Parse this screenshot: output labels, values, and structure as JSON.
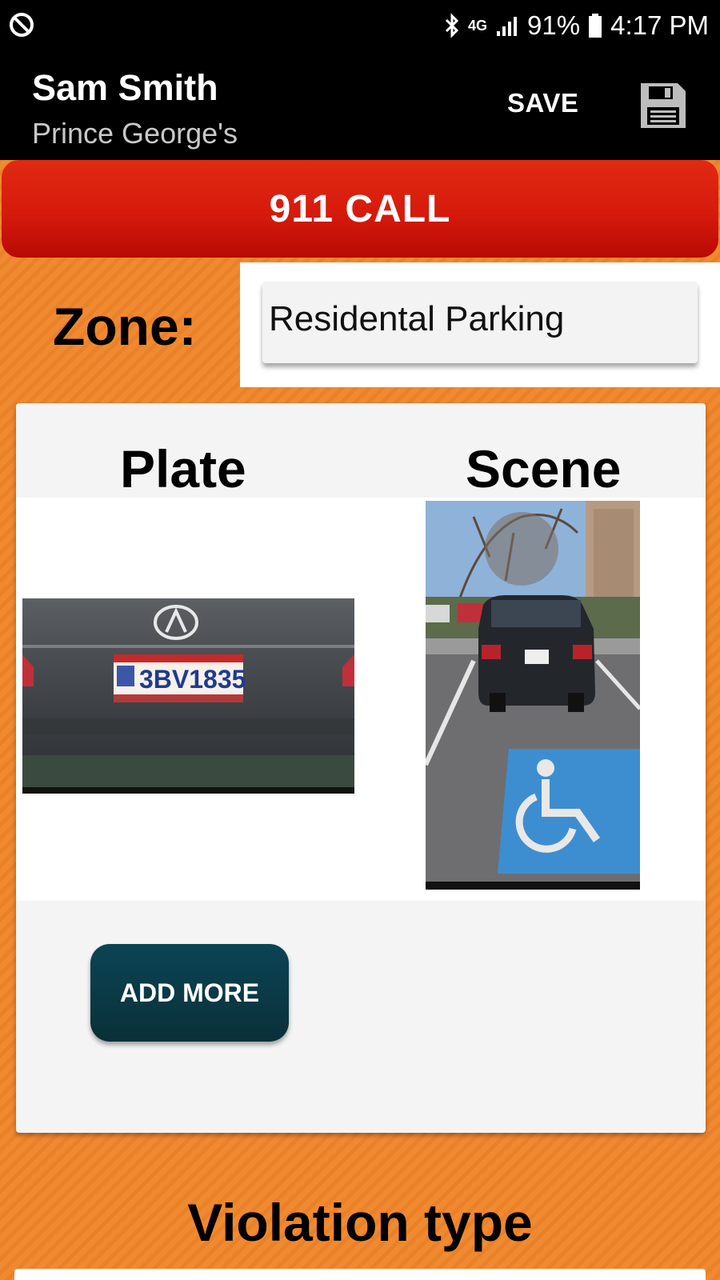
{
  "status_bar": {
    "network": "4G",
    "battery": "91%",
    "time": "4:17 PM"
  },
  "header": {
    "user_name": "Sam Smith",
    "county": "Prince George's",
    "save_label": "SAVE"
  },
  "emergency": {
    "call_label": "911 CALL"
  },
  "zone": {
    "label": "Zone:",
    "value": "Residental Parking"
  },
  "photos": {
    "plate_label": "Plate",
    "scene_label": "Scene",
    "plate_number": "3BV1835",
    "add_more_label": "ADD MORE"
  },
  "violation": {
    "title": "Violation type"
  },
  "colors": {
    "background": "#f08a30",
    "call_button": "#d61a0c",
    "add_more_button": "#0a3a46",
    "app_bar": "#000000"
  }
}
